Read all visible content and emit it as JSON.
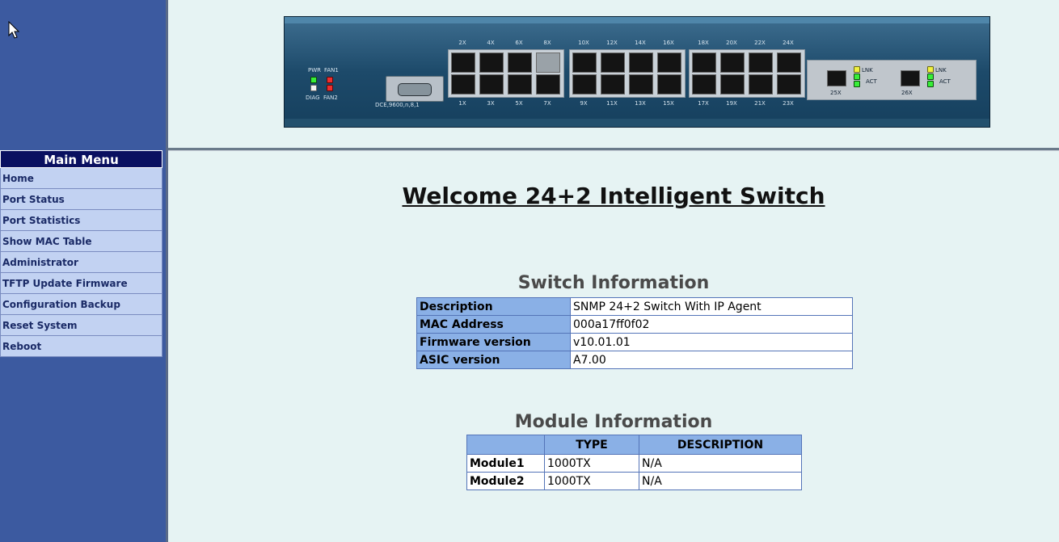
{
  "menu": {
    "title": "Main Menu",
    "items": [
      {
        "label": "Home"
      },
      {
        "label": "Port Status"
      },
      {
        "label": "Port Statistics"
      },
      {
        "label": "Show MAC Table"
      },
      {
        "label": "Administrator"
      },
      {
        "label": "TFTP Update Firmware"
      },
      {
        "label": "Configuration Backup"
      },
      {
        "label": "Reset System"
      },
      {
        "label": "Reboot"
      }
    ]
  },
  "device": {
    "led_labels": {
      "pwr": "PWR",
      "fan1": "FAN1",
      "diag": "DIAG",
      "fan2": "FAN2"
    },
    "console_label": "DCE,9600,n,8,1",
    "top_ports": [
      "2X",
      "4X",
      "6X",
      "8X",
      "10X",
      "12X",
      "14X",
      "16X",
      "18X",
      "20X",
      "22X",
      "24X"
    ],
    "bottom_ports": [
      "1X",
      "3X",
      "5X",
      "7X",
      "9X",
      "11X",
      "13X",
      "15X",
      "17X",
      "19X",
      "21X",
      "23X"
    ],
    "uplinks": [
      {
        "name": "25X",
        "lnk": "LNK",
        "act": "ACT"
      },
      {
        "name": "26X",
        "lnk": "LNK",
        "act": "ACT"
      }
    ]
  },
  "welcome": "Welcome 24+2 Intelligent Switch",
  "switch_info": {
    "title": "Switch Information",
    "rows": [
      {
        "label": "Description",
        "value": "SNMP 24+2 Switch With IP Agent"
      },
      {
        "label": "MAC Address",
        "value": "000a17ff0f02"
      },
      {
        "label": "Firmware version",
        "value": "v10.01.01"
      },
      {
        "label": "ASIC version",
        "value": "A7.00"
      }
    ]
  },
  "module_info": {
    "title": "Module Information",
    "headers": [
      "",
      "TYPE",
      "DESCRIPTION"
    ],
    "rows": [
      {
        "label": "Module1",
        "type": "1000TX",
        "description": "N/A"
      },
      {
        "label": "Module2",
        "type": "1000TX",
        "description": "N/A"
      }
    ]
  }
}
